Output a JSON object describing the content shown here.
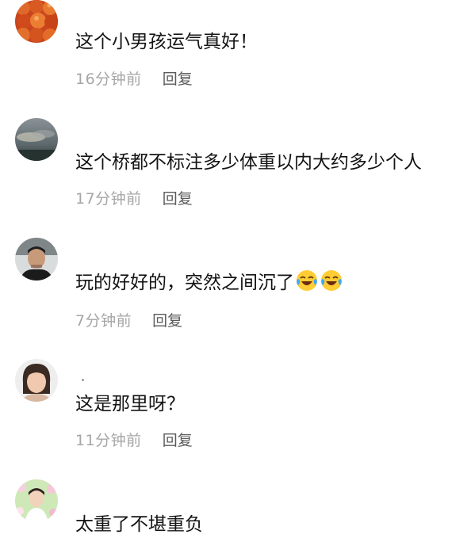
{
  "comments": [
    {
      "text": "这个小男孩运气真好！",
      "time": "16分钟前",
      "reply": "回复",
      "avatar_icon": "oranges-avatar-icon"
    },
    {
      "text": "这个桥都不标注多少体重以内大约多少个人",
      "time": "17分钟前",
      "reply": "回复",
      "avatar_icon": "cloudy-sky-avatar-icon"
    },
    {
      "text": "玩的好好的，突然之间沉了",
      "time": "7分钟前",
      "reply": "回复",
      "avatar_icon": "man-portrait-avatar-icon",
      "emoji": [
        "laughing-crying-emoji",
        "laughing-crying-emoji"
      ]
    },
    {
      "text": "这是那里呀？",
      "time": "11分钟前",
      "reply": "回复",
      "avatar_icon": "woman-portrait-avatar-icon"
    },
    {
      "text": "太重了不堪重负",
      "avatar_icon": "flowers-portrait-avatar-icon"
    }
  ],
  "colors": {
    "text": "#141414",
    "time": "#a6a6a6",
    "reply": "#5b5b5b",
    "background": "#ffffff"
  }
}
